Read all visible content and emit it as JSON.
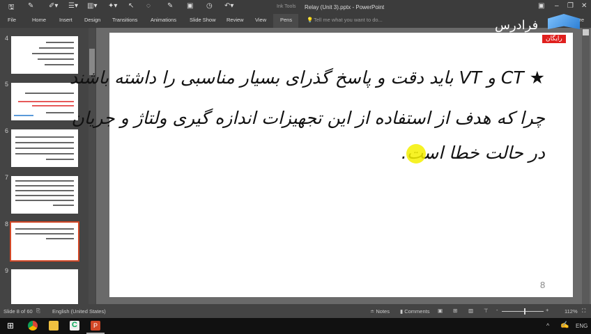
{
  "window": {
    "title": "Relay (Unit 3).pptx - PowerPoint",
    "context_label": "Ink Tools",
    "share": "Share"
  },
  "ribbon": {
    "tabs": [
      "File",
      "Home",
      "Insert",
      "Design",
      "Transitions",
      "Animations",
      "Slide Show",
      "Review",
      "View",
      "Pens"
    ],
    "active": "Pens",
    "tell_me": "Tell me what you want to do..."
  },
  "watermark": {
    "logo": "فرادرس",
    "badge": "رایگان"
  },
  "thumbnails": [
    {
      "num": "4"
    },
    {
      "num": "5"
    },
    {
      "num": "6"
    },
    {
      "num": "7"
    },
    {
      "num": "8",
      "selected": true
    },
    {
      "num": "9"
    }
  ],
  "slide": {
    "lines": [
      "★ CT و VT باید دقت و پاسخ گذرای بسیار مناسبی را داشته باشند",
      "چرا که هدف از استفاده از این تجهیزات اندازه گیری ولتاژ و جریان",
      "در حالت خطا است."
    ],
    "number": "8"
  },
  "status": {
    "slide_info": "Slide 8 of 60",
    "language": "English (United States)",
    "notes": "Notes",
    "comments": "Comments",
    "zoom": "112%",
    "zoom_percent": 112
  },
  "taskbar": {
    "lang": "ENG"
  },
  "colors": {
    "accent": "#d24726",
    "pointer": "#f5f000"
  }
}
